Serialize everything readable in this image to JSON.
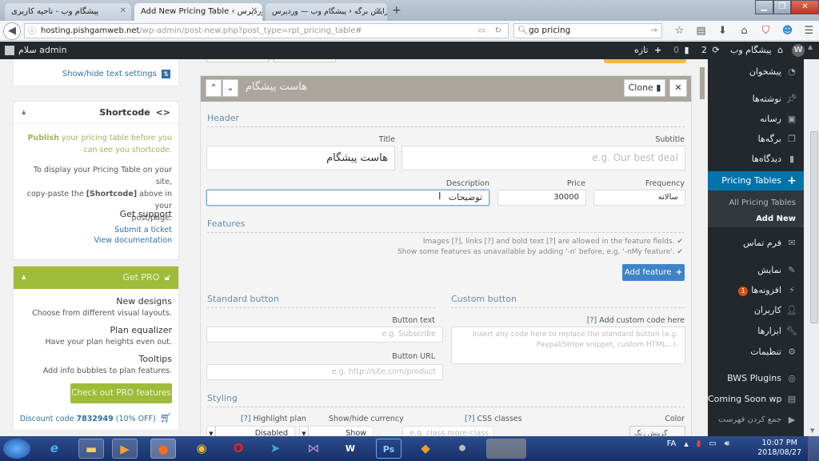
{
  "browser": {
    "tabs": [
      {
        "label": "پیشگام وب - ناحیه کاربری",
        "active": false
      },
      {
        "label": "Add New Pricing Table ‹ وردپرس ‹ وردپرس",
        "active": true
      },
      {
        "label": "ویرایش برگه ‹ پیشگام وب — وردپرس",
        "active": false
      }
    ],
    "new_tab_icon": "+",
    "url_host": "hosting.pishgamweb.net",
    "url_path": "/wp-admin/post-new.php?post_type=rpt_pricing_table#",
    "search_value": "go pricing",
    "toolbar_icons": [
      "star-icon",
      "reading-list-icon",
      "download-icon",
      "home-icon",
      "pocket-icon",
      "account-icon",
      "menu-icon"
    ]
  },
  "adminbar": {
    "greeting": "سلام admin",
    "site_name": "پیشگام وب",
    "updates_count": "2",
    "comments_count": "0",
    "new_label": "تازه"
  },
  "sidebar": {
    "text_settings_link": "Show/hide text settings",
    "shortcode": {
      "title": "Shortcode",
      "publish_bold": "Publish",
      "publish_rest": "your pricing table before you can see you shortcode.",
      "display_line1": "To display your Pricing Table on your site,",
      "display_line2_pre": "copy-paste the ",
      "display_line2_bold": "[Shortcode]",
      "display_line2_post": " above in your",
      "display_line3": "post/page.",
      "support_title": "Get support",
      "submit_ticket": "Submit a ticket",
      "view_docs": "View documentation"
    },
    "pro": {
      "title": "Get PRO",
      "features": [
        {
          "title": "New designs",
          "desc": "Choose from different visual layouts."
        },
        {
          "title": "Plan equalizer",
          "desc": "Have your plan heights even out."
        },
        {
          "title": "Tooltips",
          "desc": "Add info bubbles to plan features."
        }
      ],
      "button": "Check out PRO features",
      "discount_pre": "Discount code ",
      "discount_code": "7832949",
      "discount_post": " (10% OFF)"
    }
  },
  "plan": {
    "header_title": "هاست پیشگام",
    "clone_label": "Clone",
    "header_section": "Header",
    "title_label": "Title",
    "title_value": "هاست پیشگام",
    "subtitle_label": "Subtitle",
    "subtitle_placeholder": "e.g. Our best deal",
    "description_label": "Description",
    "description_value": "توضیحات",
    "price_label": "Price",
    "price_value": "30000",
    "frequency_label": "Frequency",
    "frequency_value": "سالانه",
    "features_section": "Features",
    "feature_hint1": "Images [?], links [?] and bold text [?] are allowed in the feature fields.",
    "feature_hint2": "Show some features as unavailable by adding '-n' before, e.g. '-nMy feature'.",
    "add_feature": "Add feature",
    "standard_button_section": "Standard button",
    "button_text_label": "Button text",
    "button_text_placeholder": "e.g. Subscribe",
    "button_url_label": "Button URL",
    "button_url_placeholder": "e.g. http://site.com/product",
    "custom_button_section": "Custom button",
    "custom_code_label": "Add custom code here",
    "custom_code_help": "[?]",
    "custom_code_placeholder": "Insert any code here to replace the standard button (e.g. Paypal/Stripe snippet, custom HTML...).",
    "styling_section": "Styling",
    "highlight_label": "Highlight plan",
    "highlight_value": "Disabled",
    "currency_label": "Show/hide currency",
    "currency_value": "Show",
    "css_label": "CSS classes",
    "css_placeholder": "e.g. class more-class",
    "color_label": "Color",
    "color_button": "گزینش رنگ",
    "help": "[?]"
  },
  "wpmenu": {
    "items": [
      {
        "label": "پیشخوان",
        "icon": "dashboard-icon"
      },
      {
        "label": "نوشته‌ها",
        "icon": "pin-icon"
      },
      {
        "label": "رسانه",
        "icon": "media-icon"
      },
      {
        "label": "برگه‌ها",
        "icon": "pages-icon"
      },
      {
        "label": "دیدگاه‌ها",
        "icon": "comments-icon"
      },
      {
        "label": "Pricing Tables",
        "icon": "plus-icon",
        "active": true
      },
      {
        "label": "فرم تماس",
        "icon": "mail-icon"
      },
      {
        "label": "نمایش",
        "icon": "brush-icon"
      },
      {
        "label": "افزونه‌ها",
        "icon": "plugin-icon",
        "badge": "1"
      },
      {
        "label": "کاربران",
        "icon": "user-icon"
      },
      {
        "label": "ابزارها",
        "icon": "wrench-icon"
      },
      {
        "label": "تنظیمات",
        "icon": "settings-icon"
      },
      {
        "label": "BWS Plugins",
        "icon": "bws-icon"
      },
      {
        "label": "Coming Soon wp",
        "icon": "document-icon"
      },
      {
        "label": "جمع کردن فهرست",
        "icon": "collapse-icon"
      }
    ],
    "submenu": [
      "All Pricing Tables",
      "Add New"
    ]
  },
  "taskbar": {
    "apps": [
      "start",
      "internet-explorer",
      "file-explorer",
      "media-player",
      "firefox",
      "chrome",
      "opera",
      "telegram",
      "visual-studio",
      "word",
      "photoshop",
      "paint",
      "nox"
    ],
    "lang": "FA",
    "time": "10:07 PM",
    "date": "2018/08/27"
  },
  "colors": {
    "wp_admin_dark": "#23282d",
    "wp_blue": "#0073aa",
    "pro_green": "#a0bb3a",
    "panel_header": "#aba69d",
    "section_blue": "#6a8bab"
  }
}
